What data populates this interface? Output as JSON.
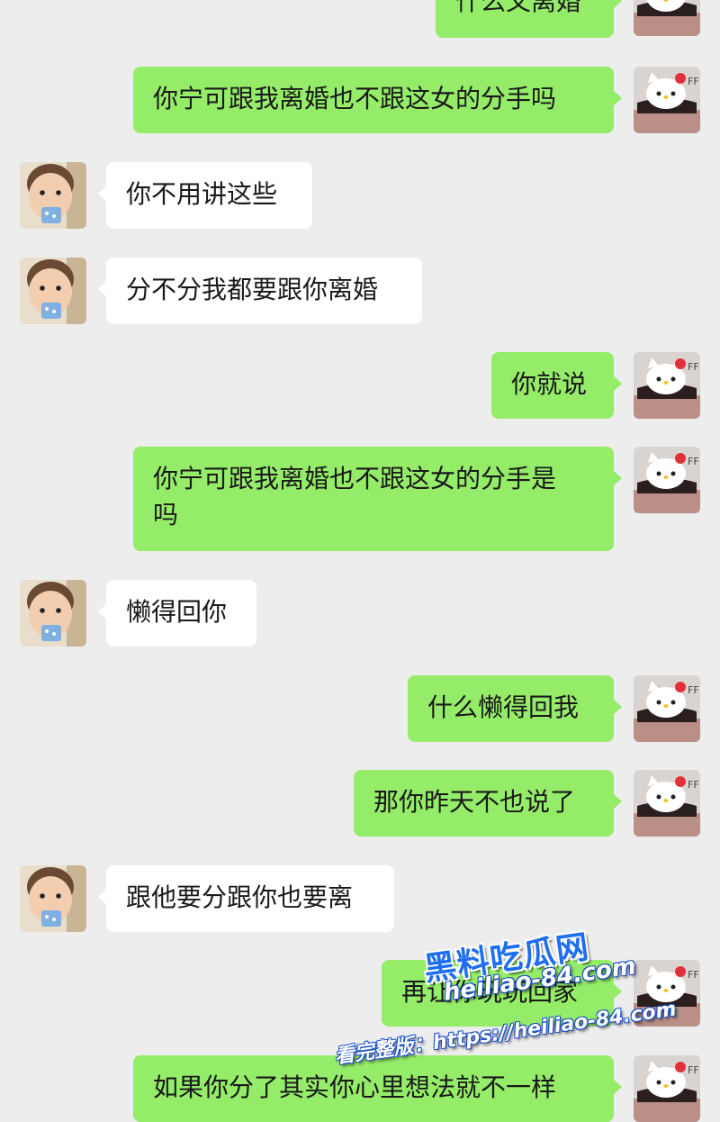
{
  "chat": {
    "messages": [
      {
        "side": "me",
        "text": "什么又离婚"
      },
      {
        "side": "me",
        "text": "你宁可跟我离婚也不跟这女的分手吗"
      },
      {
        "side": "them",
        "text": "你不用讲这些"
      },
      {
        "side": "them",
        "text": "分不分我都要跟你离婚"
      },
      {
        "side": "me",
        "text": "你就说"
      },
      {
        "side": "me",
        "text": "你宁可跟我离婚也不跟这女的分手是\n吗"
      },
      {
        "side": "them",
        "text": "懒得回你"
      },
      {
        "side": "me",
        "text": "什么懒得回我"
      },
      {
        "side": "me",
        "text": "那你昨天不也说了"
      },
      {
        "side": "them",
        "text": "跟他要分跟你也要离"
      },
      {
        "side": "me",
        "text": "再让你玩玩回家"
      },
      {
        "side": "me",
        "text": "如果你分了其实你心里想法就不一样"
      }
    ]
  },
  "colors": {
    "background": "#ededed",
    "my_bubble": "#95ec69",
    "their_bubble": "#ffffff"
  },
  "avatars": {
    "me": "hello-kitty-avatar-icon",
    "them": "baby-avatar-icon"
  },
  "watermark": {
    "title": "黑料吃瓜网",
    "url": "heiliao-84.com",
    "line": "看完整版：https://heiliao-84.com"
  }
}
